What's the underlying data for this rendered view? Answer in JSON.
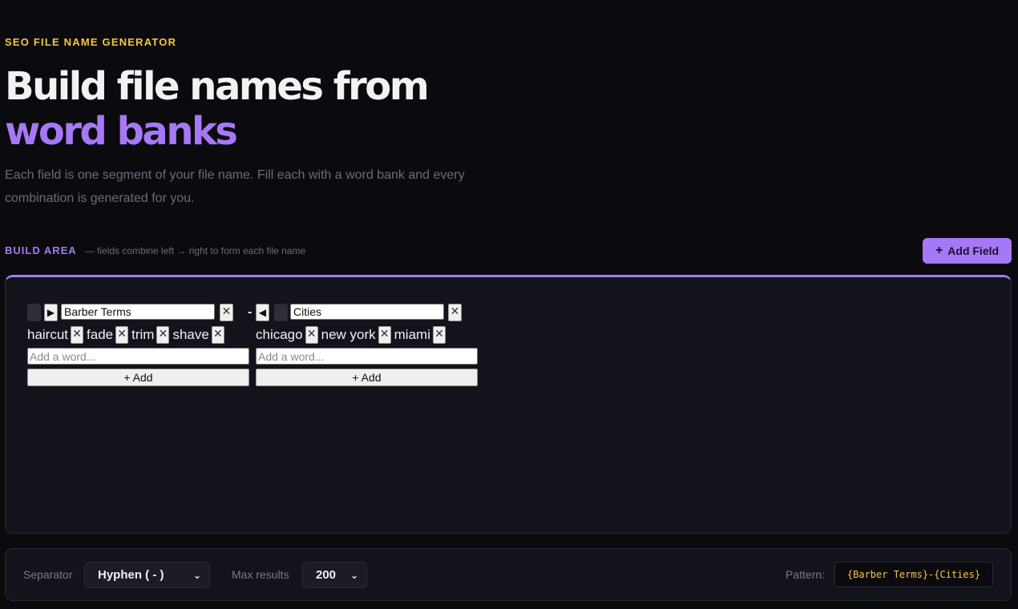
{
  "hero": {
    "eyebrow": "SEO FILE NAME GENERATOR",
    "title_line1": "Build file names from",
    "title_line2": "word banks",
    "description": "Each field is one segment of your file name. Fill each with a word bank and every combination is generated for you."
  },
  "build": {
    "label": "BUILD AREA",
    "hint": "— fields combine left → right to form each file name",
    "add_field_label": "Add Field",
    "add_field_icon": "plus-icon",
    "separator_char": "-",
    "fields": [
      {
        "name": "Barber Terms",
        "arrow": "▶",
        "words": [
          "haircut",
          "fade",
          "trim",
          "shave"
        ],
        "placeholder": "Add a word...",
        "add_label": "+ Add"
      },
      {
        "name": "Cities",
        "arrow": "◀",
        "words": [
          "chicago",
          "new york",
          "miami"
        ],
        "placeholder": "Add a word...",
        "add_label": "+ Add"
      }
    ],
    "remove_glyph": "✕"
  },
  "options": {
    "separator_label": "Separator",
    "separator_value": "Hyphen ( - )",
    "max_results_label": "Max results",
    "max_results_value": "200",
    "pattern_label": "Pattern:",
    "pattern_value": "{Barber Terms}-{Cities}"
  },
  "colors": {
    "background": "#0b0b0f",
    "accent": "#a678f5",
    "eyebrow": "#f5c542",
    "panel": "#13131b"
  }
}
